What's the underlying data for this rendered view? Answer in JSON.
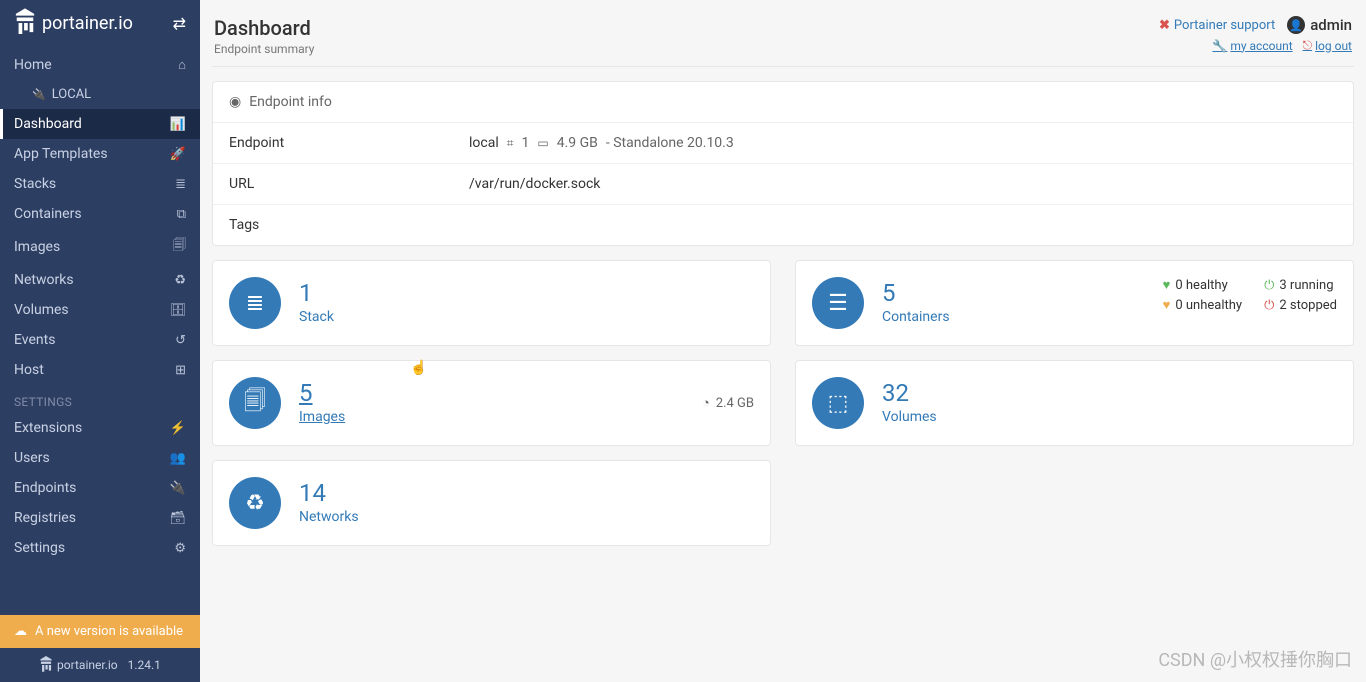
{
  "brand": "portainer.io",
  "sidebar": {
    "home": "Home",
    "local": "LOCAL",
    "items": [
      {
        "label": "Dashboard",
        "icon": "📊"
      },
      {
        "label": "App Templates",
        "icon": "🚀"
      },
      {
        "label": "Stacks",
        "icon": "≣"
      },
      {
        "label": "Containers",
        "icon": "⧉"
      },
      {
        "label": "Images",
        "icon": "🗐"
      },
      {
        "label": "Networks",
        "icon": "♻"
      },
      {
        "label": "Volumes",
        "icon": "🗄"
      },
      {
        "label": "Events",
        "icon": "↺"
      },
      {
        "label": "Host",
        "icon": "⊞"
      }
    ],
    "settings_header": "SETTINGS",
    "settings": [
      {
        "label": "Extensions",
        "icon": "⚡"
      },
      {
        "label": "Users",
        "icon": "👥"
      },
      {
        "label": "Endpoints",
        "icon": "🔌"
      },
      {
        "label": "Registries",
        "icon": "🗃"
      },
      {
        "label": "Settings",
        "icon": "⚙"
      }
    ],
    "update": "A new version is available",
    "version": "1.24.1"
  },
  "header": {
    "title": "Dashboard",
    "subtitle": "Endpoint summary",
    "support": "Portainer support",
    "user": "admin",
    "my_account": "my account",
    "log_out": "log out"
  },
  "endpoint_info": {
    "panel_title": "Endpoint info",
    "rows": {
      "endpoint_label": "Endpoint",
      "endpoint_name": "local",
      "cpu": "1",
      "ram": "4.9 GB",
      "mode": "- Standalone 20.10.3",
      "url_label": "URL",
      "url_value": "/var/run/docker.sock",
      "tags_label": "Tags",
      "tags_value": ""
    }
  },
  "tiles": {
    "stack": {
      "count": "1",
      "label": "Stack"
    },
    "containers": {
      "count": "5",
      "label": "Containers",
      "healthy": "0 healthy",
      "unhealthy": "0 unhealthy",
      "running": "3 running",
      "stopped": "2 stopped"
    },
    "images": {
      "count": "5",
      "label": "Images",
      "size": "2.4 GB"
    },
    "volumes": {
      "count": "32",
      "label": "Volumes"
    },
    "networks": {
      "count": "14",
      "label": "Networks"
    }
  },
  "watermark": "CSDN @小权权捶你胸口"
}
